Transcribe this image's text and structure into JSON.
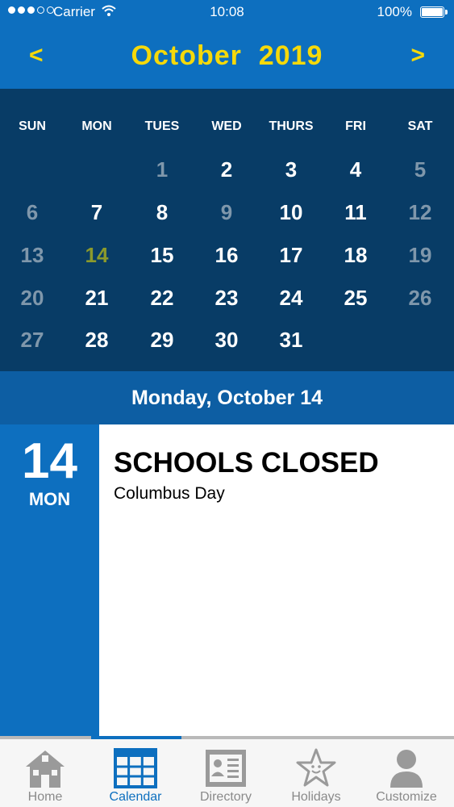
{
  "status_bar": {
    "carrier": "Carrier",
    "time": "10:08",
    "battery": "100%"
  },
  "header": {
    "title": "October  2019",
    "prev": "<",
    "next": ">"
  },
  "weekdays": [
    "SUN",
    "MON",
    "TUES",
    "WED",
    "THURS",
    "FRI",
    "SAT"
  ],
  "weeks": [
    [
      null,
      null,
      "1",
      "2",
      "3",
      "4",
      "5"
    ],
    [
      "6",
      "7",
      "8",
      "9",
      "10",
      "11",
      "12"
    ],
    [
      "13",
      "14",
      "15",
      "16",
      "17",
      "18",
      "19"
    ],
    [
      "20",
      "21",
      "22",
      "23",
      "24",
      "25",
      "26"
    ],
    [
      "27",
      "28",
      "29",
      "30",
      "31",
      null,
      null
    ]
  ],
  "dimmed_days": [
    "1",
    "5",
    "6",
    "9",
    "12",
    "13",
    "19",
    "20",
    "26",
    "27"
  ],
  "today": "14",
  "selected_date_label": "Monday, October 14",
  "event_panel": {
    "day_number": "14",
    "day_abbr": "MON",
    "title": "SCHOOLS CLOSED",
    "subtitle": "Columbus Day"
  },
  "tabs": [
    {
      "label": "Home",
      "icon": "school-house-icon"
    },
    {
      "label": "Calendar",
      "icon": "calendar-grid-icon"
    },
    {
      "label": "Directory",
      "icon": "directory-card-icon"
    },
    {
      "label": "Holidays",
      "icon": "star-icon"
    },
    {
      "label": "Customize",
      "icon": "person-icon"
    }
  ],
  "active_tab": "Calendar",
  "colors": {
    "primary_blue": "#0d6fbf",
    "calendar_bg": "#083c66",
    "accent_yellow": "#f5d90a",
    "today_olive": "#8b9a2c",
    "dim_day": "#7f97ab",
    "tab_gray": "#8a8a8a"
  }
}
